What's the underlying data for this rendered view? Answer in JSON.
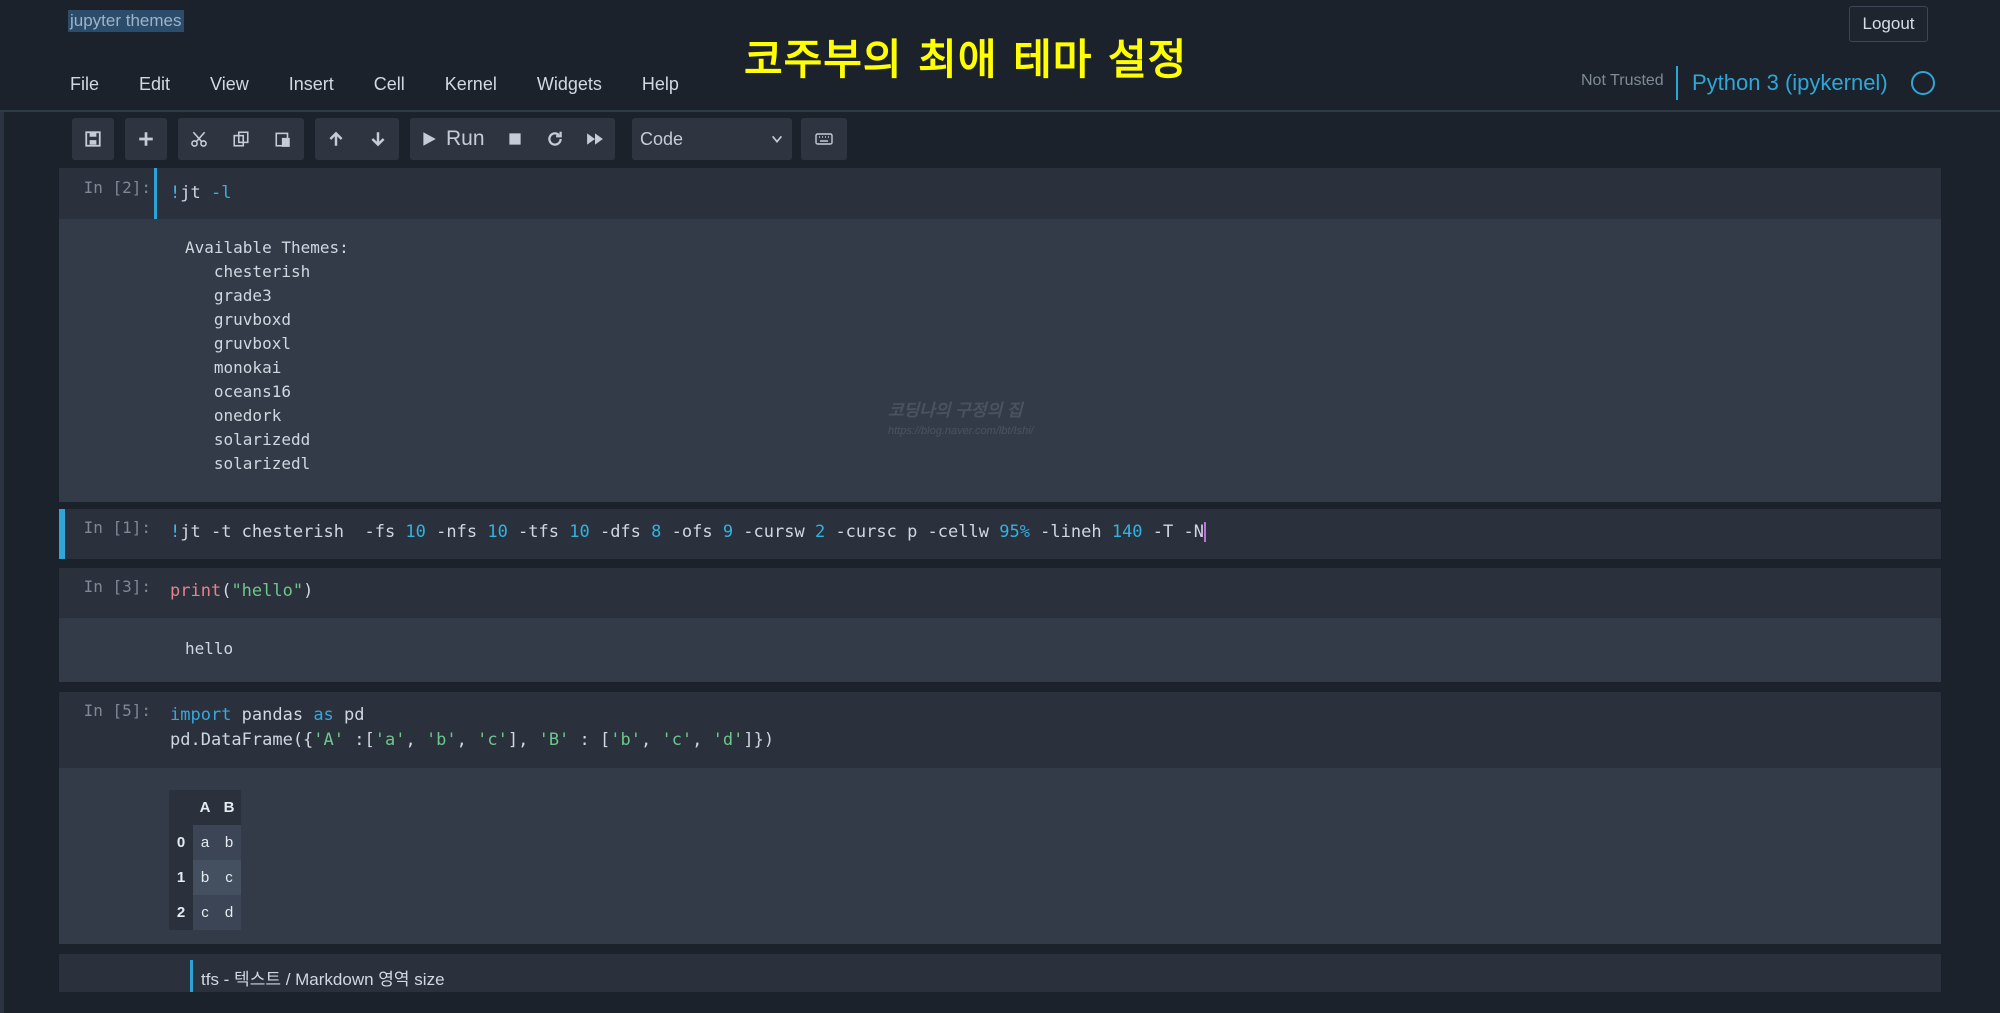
{
  "header": {
    "notebook_name": "jupyter themes",
    "overlay_title": "코주부의 최애 테마 설정",
    "logout_label": "Logout",
    "menu": [
      "File",
      "Edit",
      "View",
      "Insert",
      "Cell",
      "Kernel",
      "Widgets",
      "Help"
    ],
    "trust_status": "Not Trusted",
    "kernel_name": "Python 3 (ipykernel)"
  },
  "toolbar": {
    "run_label": "Run",
    "cell_type": "Code",
    "icons": [
      "save-icon",
      "plus-icon",
      "cut-icon",
      "copy-icon",
      "paste-icon",
      "arrow-up-icon",
      "arrow-down-icon",
      "play-icon",
      "stop-icon",
      "restart-icon",
      "fast-forward-icon",
      "keyboard-icon"
    ]
  },
  "cells": {
    "c1": {
      "prompt": "In [2]:",
      "output_lines": [
        "Available Themes:",
        "   chesterish",
        "   grade3",
        "   gruvboxd",
        "   gruvboxl",
        "   monokai",
        "   oceans16",
        "   onedork",
        "   solarizedd",
        "   solarizedl"
      ]
    },
    "c2": {
      "prompt": "In [1]:"
    },
    "c3": {
      "prompt": "In [3]:",
      "output": "hello"
    },
    "c4": {
      "prompt": "In [5]:",
      "dataframe": {
        "columns": [
          "A",
          "B"
        ],
        "rows": [
          [
            "0",
            "a",
            "b"
          ],
          [
            "1",
            "b",
            "c"
          ],
          [
            "2",
            "c",
            "d"
          ]
        ]
      }
    },
    "markdown": {
      "text": "tfs - 텍스트 / Markdown 영역 size"
    }
  },
  "watermark": {
    "line1": "코딩나의 구정의 집",
    "line2": "https://blog.naver.com/lbt/Ishi/"
  },
  "colors": {
    "background": "#1c222b",
    "accent": "#30a6d8",
    "title_highlight": "#ffff00"
  }
}
